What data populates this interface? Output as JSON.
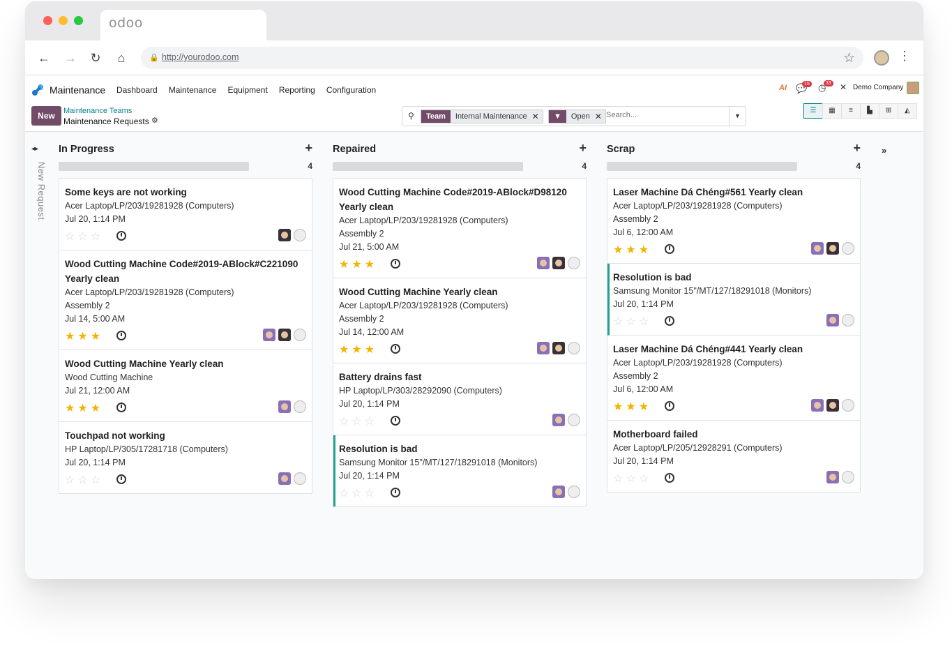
{
  "browser": {
    "tab_title": "odoo",
    "url": "http://yourodoo.com"
  },
  "navbar": {
    "app_name": "Maintenance",
    "menu": [
      "Dashboard",
      "Maintenance",
      "Equipment",
      "Reporting",
      "Configuration"
    ],
    "ai_label": "AI",
    "messages_count": "15",
    "activities_count": "33",
    "company": "Demo Company"
  },
  "control": {
    "new_label": "New",
    "breadcrumb_parent": "Maintenance Teams",
    "breadcrumb_current": "Maintenance Requests",
    "facets": [
      {
        "label": "Team",
        "value": "Internal Maintenance"
      },
      {
        "label": "▼",
        "value": "Open"
      }
    ],
    "search_placeholder": "Search..."
  },
  "kanban": {
    "quick_create_label": "New Request",
    "columns": [
      {
        "title": "In Progress",
        "count": "4",
        "cards": [
          {
            "title": "Some keys are not working",
            "lines": [
              "Acer Laptop/LP/203/19281928 (Computers)",
              "Jul 20, 1:14 PM"
            ],
            "priority": 0,
            "avatars": [
              "dark"
            ],
            "accent": false
          },
          {
            "title": "Wood Cutting Machine Code#2019-ABlock#C221090 Yearly clean",
            "lines": [
              "Acer Laptop/LP/203/19281928 (Computers)",
              "Assembly 2",
              "Jul 14, 5:00 AM"
            ],
            "priority": 3,
            "avatars": [
              "purple",
              "dark"
            ],
            "accent": false
          },
          {
            "title": "Wood Cutting Machine Yearly clean",
            "lines": [
              "Wood Cutting Machine",
              "Jul 21, 12:00 AM"
            ],
            "priority": 3,
            "avatars": [
              "purple"
            ],
            "accent": false
          },
          {
            "title": "Touchpad not working",
            "lines": [
              "HP Laptop/LP/305/17281718 (Computers)",
              "Jul 20, 1:14 PM"
            ],
            "priority": 0,
            "avatars": [
              "purple"
            ],
            "accent": false
          }
        ]
      },
      {
        "title": "Repaired",
        "count": "4",
        "cards": [
          {
            "title": "Wood Cutting Machine Code#2019-ABlock#D98120 Yearly clean",
            "lines": [
              "Acer Laptop/LP/203/19281928 (Computers)",
              "Assembly 2",
              "Jul 21, 5:00 AM"
            ],
            "priority": 3,
            "avatars": [
              "purple",
              "dark"
            ],
            "accent": false
          },
          {
            "title": "Wood Cutting Machine Yearly clean",
            "lines": [
              "Acer Laptop/LP/203/19281928 (Computers)",
              "Assembly 2",
              "Jul 14, 12:00 AM"
            ],
            "priority": 3,
            "avatars": [
              "purple",
              "dark"
            ],
            "accent": false
          },
          {
            "title": "Battery drains fast",
            "lines": [
              "HP Laptop/LP/303/28292090 (Computers)",
              "Jul 20, 1:14 PM"
            ],
            "priority": 0,
            "avatars": [
              "purple"
            ],
            "accent": false
          },
          {
            "title": "Resolution is bad",
            "lines": [
              "Samsung Monitor 15\"/MT/127/18291018 (Monitors)",
              "Jul 20, 1:14 PM"
            ],
            "priority": 0,
            "avatars": [
              "purple"
            ],
            "accent": true
          }
        ]
      },
      {
        "title": "Scrap",
        "count": "4",
        "cards": [
          {
            "title": "Laser Machine Dá Chéng#561 Yearly clean",
            "lines": [
              "Acer Laptop/LP/203/19281928 (Computers)",
              "Assembly 2",
              "Jul 6, 12:00 AM"
            ],
            "priority": 3,
            "avatars": [
              "purple",
              "dark"
            ],
            "accent": false
          },
          {
            "title": "Resolution is bad",
            "lines": [
              "Samsung Monitor 15\"/MT/127/18291018 (Monitors)",
              "Jul 20, 1:14 PM"
            ],
            "priority": 0,
            "avatars": [
              "purple"
            ],
            "accent": true
          },
          {
            "title": "Laser Machine Dá Chéng#441 Yearly clean",
            "lines": [
              "Acer Laptop/LP/203/19281928 (Computers)",
              "Assembly 2",
              "Jul 6, 12:00 AM"
            ],
            "priority": 3,
            "avatars": [
              "purple",
              "dark"
            ],
            "accent": false
          },
          {
            "title": "Motherboard failed",
            "lines": [
              "Acer Laptop/LP/205/12928291 (Computers)",
              "Jul 20, 1:14 PM"
            ],
            "priority": 0,
            "avatars": [
              "purple"
            ],
            "accent": false
          }
        ]
      }
    ]
  },
  "colors": {
    "brand": "#714b67",
    "link": "#017e84",
    "star": "#f3b400",
    "accent_bar": "#21a08d"
  }
}
